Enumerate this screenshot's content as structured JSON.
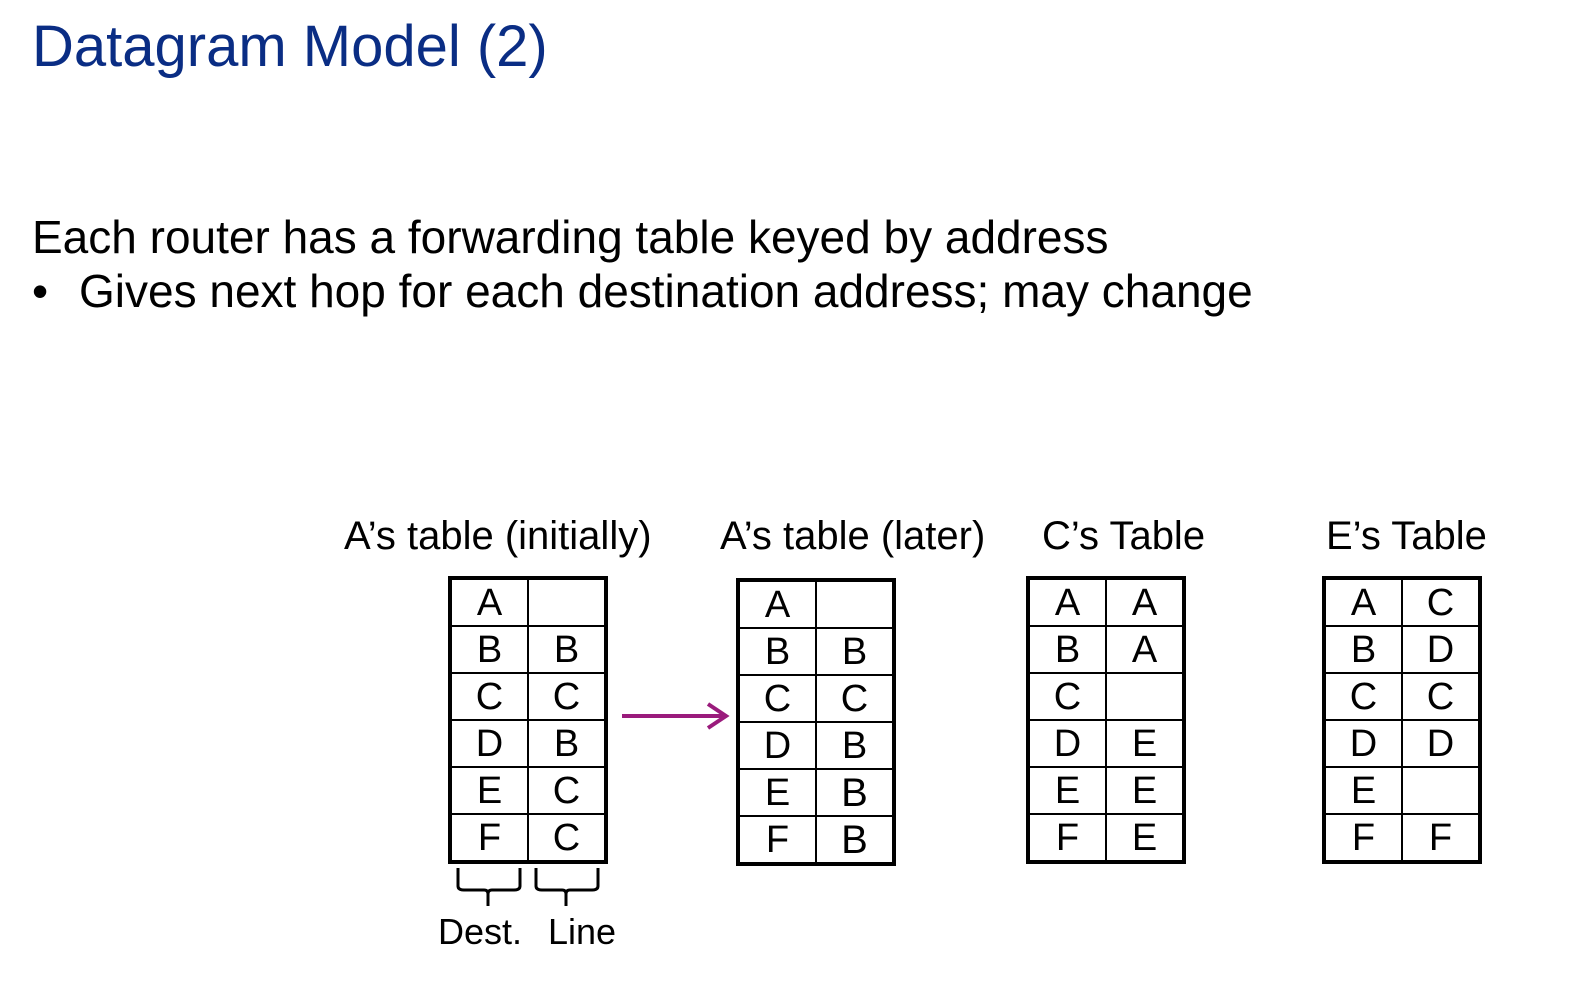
{
  "slide": {
    "title": "Datagram Model (2)",
    "body_line": "Each router has a forwarding table keyed by address",
    "bullet_symbol": "•",
    "bullet_text": "Gives next hop for each destination address; may change"
  },
  "colors": {
    "title": "#0a2d84",
    "arrow": "#9a1b7c",
    "text": "#000000"
  },
  "tables": [
    {
      "caption": "A’s table (initially)",
      "rows": [
        [
          "A",
          ""
        ],
        [
          "B",
          "B"
        ],
        [
          "C",
          "C"
        ],
        [
          "D",
          "B"
        ],
        [
          "E",
          "C"
        ],
        [
          "F",
          "C"
        ]
      ]
    },
    {
      "caption": "A’s table (later)",
      "rows": [
        [
          "A",
          ""
        ],
        [
          "B",
          "B"
        ],
        [
          "C",
          "C"
        ],
        [
          "D",
          "B"
        ],
        [
          "E",
          "B"
        ],
        [
          "F",
          "B"
        ]
      ]
    },
    {
      "caption": "C’s Table",
      "rows": [
        [
          "A",
          "A"
        ],
        [
          "B",
          "A"
        ],
        [
          "C",
          ""
        ],
        [
          "D",
          "E"
        ],
        [
          "E",
          "E"
        ],
        [
          "F",
          "E"
        ]
      ]
    },
    {
      "caption": "E’s Table",
      "rows": [
        [
          "A",
          "C"
        ],
        [
          "B",
          "D"
        ],
        [
          "C",
          "C"
        ],
        [
          "D",
          "D"
        ],
        [
          "E",
          ""
        ],
        [
          "F",
          "F"
        ]
      ]
    }
  ],
  "column_labels": {
    "dest": "Dest.",
    "line": "Line"
  }
}
